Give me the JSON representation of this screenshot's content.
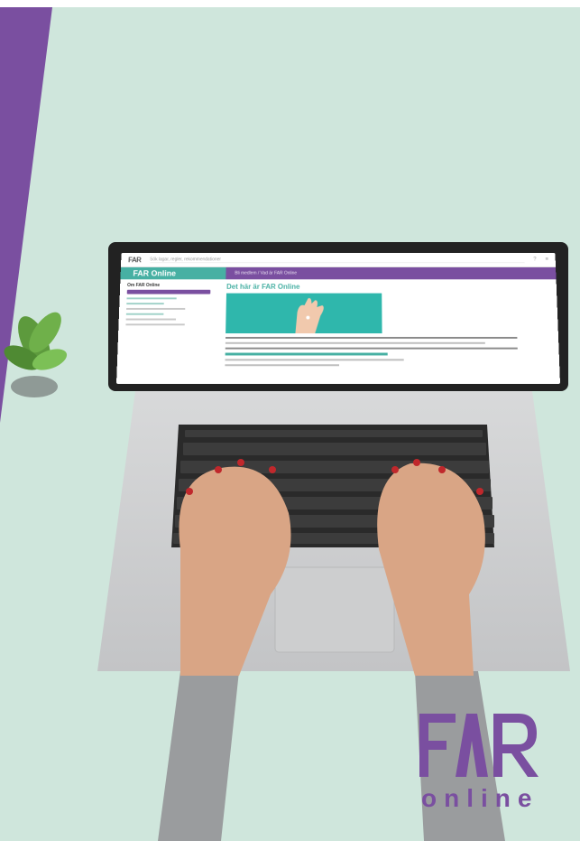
{
  "screen": {
    "topbar": {
      "logo": "FAR",
      "search_placeholder": "Sök lagar, regler, rekommendationer",
      "icon_help": "?",
      "icon_menu": "≡"
    },
    "banner": {
      "app_name": "FAR Online",
      "breadcrumb": "Bli medlem / Vad är FAR Online"
    },
    "sidebar": {
      "heading": "Om FAR Online"
    },
    "main": {
      "title": "Det här är FAR Online"
    }
  },
  "brand": {
    "text": "online"
  },
  "colors": {
    "purple": "#7a4fa0",
    "teal": "#47b0a3",
    "background": "#cfe6dc"
  }
}
